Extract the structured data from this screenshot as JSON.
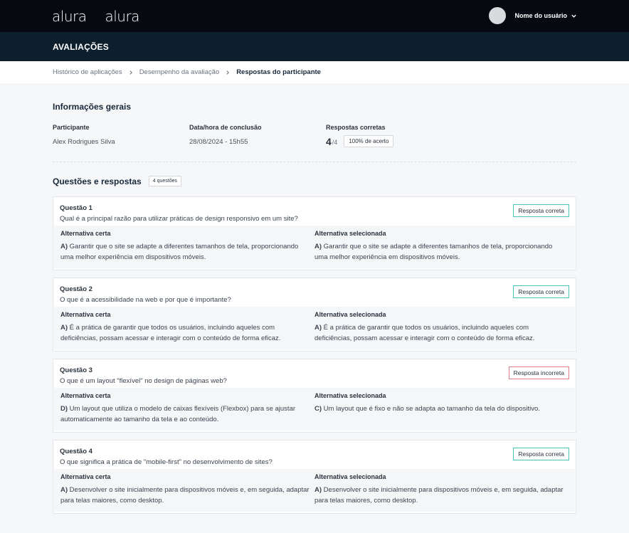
{
  "header": {
    "logos": [
      "alura",
      "alura"
    ],
    "user_name": "Nome do usuário"
  },
  "page_title": "AVALIAÇÕES",
  "breadcrumb": [
    "Histórico de aplicações",
    "Desempenho da avaliação",
    "Respostas do participante"
  ],
  "info": {
    "title": "Informações gerais",
    "participant_label": "Participante",
    "participant": "Alex Rodrigues Silva",
    "date_label": "Data/hora de conclusão",
    "date": "28/08/2024 - 15h55",
    "correct_label": "Respostas corretas",
    "correct": "4",
    "total": "/4",
    "percent": "100% de acerto"
  },
  "questions_section": {
    "title": "Questões e respostas",
    "count": "4 questões",
    "correct_label": "Alternativa certa",
    "selected_label": "Alternativa selecionada"
  },
  "questions": [
    {
      "number": "Questão 1",
      "text": "Qual é a principal razão para utilizar práticas de design responsivo em um site?",
      "status": "Resposta correta",
      "correct_letter": "A)",
      "correct_text": "Garantir que o site se adapte a diferentes tamanhos de tela, proporcionando uma melhor experiência em dispositivos móveis.",
      "selected_letter": "A)",
      "selected_text": "Garantir que o site se adapte a diferentes tamanhos de tela, proporcionando uma melhor experiência em dispositivos móveis."
    },
    {
      "number": "Questão 2",
      "text": "O que é a acessibilidade na web e por que é importante?",
      "status": "Resposta correta",
      "correct_letter": "A)",
      "correct_text": "É a prática de garantir que todos os usuários, incluindo aqueles com deficiências, possam acessar e interagir com o conteúdo de forma eficaz.",
      "selected_letter": "A)",
      "selected_text": "É a prática de garantir que todos os usuários, incluindo aqueles com deficiências, possam acessar e interagir com o conteúdo de forma eficaz."
    },
    {
      "number": "Questão 3",
      "text": "O que é um layout \"flexível\" no design de páginas web?",
      "status": "Resposta incorreta",
      "correct_letter": "D)",
      "correct_text": "Um layout que utiliza o modelo de caixas flexíveis (Flexbox) para se ajustar automaticamente ao tamanho da tela e ao conteúdo.",
      "selected_letter": "C)",
      "selected_text": "Um layout que é fixo e não se adapta ao tamanho da tela do dispositivo."
    },
    {
      "number": "Questão 4",
      "text": "O que significa a prática de \"mobile-first\" no desenvolvimento de sites?",
      "status": "Resposta correta",
      "correct_letter": "A)",
      "correct_text": "Desenvolver o site inicialmente para dispositivos móveis e, em seguida, adaptar para telas maiores, como desktop.",
      "selected_letter": "A)",
      "selected_text": "Desenvolver o site inicialmente para dispositivos móveis e, em seguida, adaptar para telas maiores, como desktop."
    }
  ]
}
